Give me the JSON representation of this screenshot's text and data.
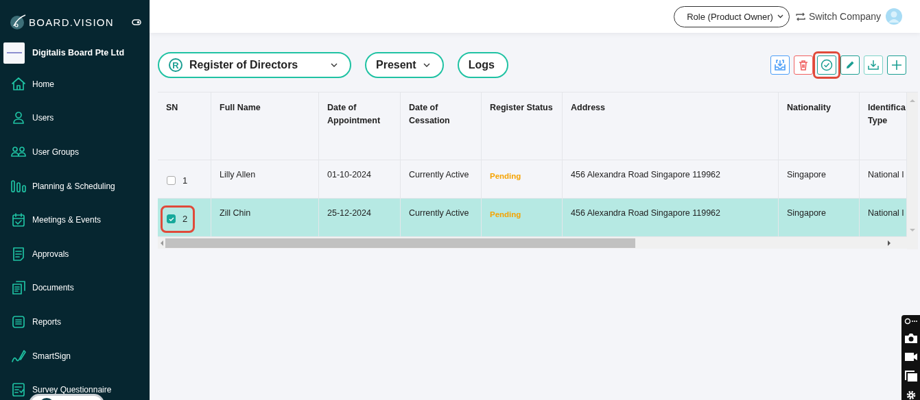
{
  "sidebar": {
    "brand": "BOARD.VISION",
    "company": "Digitalis Board Pte Ltd",
    "items": [
      {
        "label": "Home",
        "kind": "home"
      },
      {
        "label": "Users",
        "kind": "user"
      },
      {
        "label": "User Groups",
        "kind": "users"
      },
      {
        "label": "Planning & Scheduling",
        "kind": "bars"
      },
      {
        "label": "Meetings & Events",
        "kind": "calendar"
      },
      {
        "label": "Approvals",
        "kind": "doc"
      },
      {
        "label": "Documents",
        "kind": "docs"
      },
      {
        "label": "Reports",
        "kind": "list"
      },
      {
        "label": "SmartSign",
        "kind": "pen"
      },
      {
        "label": "Survey Questionnaire",
        "kind": "survey"
      }
    ]
  },
  "header": {
    "role": "Role (Product Owner)",
    "switch": "Switch Company"
  },
  "filters": [
    {
      "kind": "register",
      "label": "Register of Directors",
      "badge": "R"
    },
    {
      "kind": "select",
      "label": "Present"
    },
    {
      "kind": "button",
      "label": "Logs"
    }
  ],
  "actions": [
    {
      "kind": "import",
      "highlighted": false
    },
    {
      "kind": "delete",
      "highlighted": false
    },
    {
      "kind": "approve",
      "highlighted": true
    },
    {
      "kind": "edit",
      "highlighted": false
    },
    {
      "kind": "download",
      "highlighted": false
    },
    {
      "kind": "add",
      "highlighted": false
    }
  ],
  "table": {
    "columns": [
      "SN",
      "Full Name",
      "Date of Appointment",
      "Date of Cessation",
      "Register Status",
      "Address",
      "Nationality",
      "Identifica Type"
    ],
    "rows": [
      {
        "selected": false,
        "highlighted": false,
        "cells": [
          "1",
          "Lilly Allen",
          "01-10-2024",
          "Currently Active",
          "Pending",
          "456 Alexandra Road Singapore 119962",
          "Singapore",
          "National I"
        ]
      },
      {
        "selected": true,
        "highlighted": true,
        "cells": [
          "2",
          "Zill Chin",
          "25-12-2024",
          "Currently Active",
          "Pending",
          "456 Alexandra Road Singapore 119962",
          "Singapore",
          "National I"
        ]
      }
    ]
  }
}
